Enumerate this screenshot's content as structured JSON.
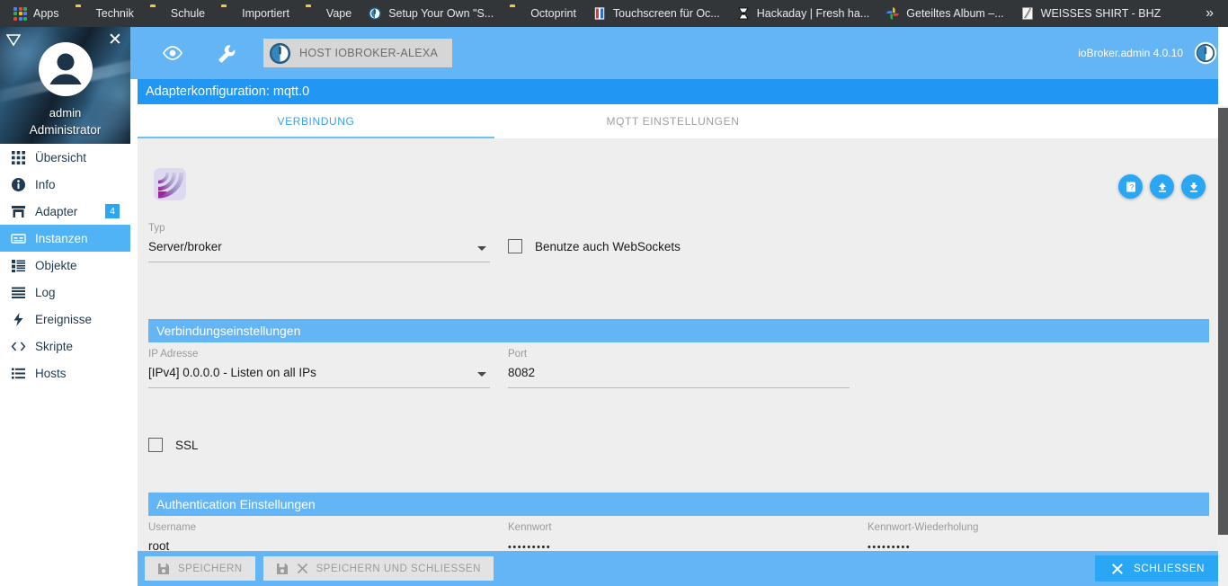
{
  "browser": {
    "bookmarks": [
      {
        "label": "Apps",
        "icon": "apps-grid-icon"
      },
      {
        "label": "Technik",
        "icon": "folder-icon"
      },
      {
        "label": "Schule",
        "icon": "folder-icon"
      },
      {
        "label": "Importiert",
        "icon": "folder-icon"
      },
      {
        "label": "Vape",
        "icon": "folder-icon"
      },
      {
        "label": "Setup Your Own \"S...",
        "icon": "iobroker-icon"
      },
      {
        "label": "Octoprint",
        "icon": "folder-icon"
      },
      {
        "label": "Touchscreen für Oc...",
        "icon": "site-icon"
      },
      {
        "label": "Hackaday | Fresh ha...",
        "icon": "hackaday-icon"
      },
      {
        "label": "Geteiltes Album –...",
        "icon": "google-photos-icon"
      },
      {
        "label": "WEISSES SHIRT - BHZ",
        "icon": "music-icon"
      }
    ],
    "overflow_label": "»"
  },
  "sidebar": {
    "user": "admin",
    "role": "Administrator",
    "items": [
      {
        "label": "Übersicht",
        "icon": "grid-icon",
        "active": false,
        "badge": ""
      },
      {
        "label": "Info",
        "icon": "info-icon",
        "active": false,
        "badge": ""
      },
      {
        "label": "Adapter",
        "icon": "store-icon",
        "active": false,
        "badge": "4"
      },
      {
        "label": "Instanzen",
        "icon": "instance-icon",
        "active": true,
        "badge": ""
      },
      {
        "label": "Objekte",
        "icon": "list-icon",
        "active": false,
        "badge": ""
      },
      {
        "label": "Log",
        "icon": "log-icon",
        "active": false,
        "badge": ""
      },
      {
        "label": "Ereignisse",
        "icon": "bolt-icon",
        "active": false,
        "badge": ""
      },
      {
        "label": "Skripte",
        "icon": "code-icon",
        "active": false,
        "badge": ""
      },
      {
        "label": "Hosts",
        "icon": "hosts-icon",
        "active": false,
        "badge": ""
      }
    ]
  },
  "topbar": {
    "host_chip": "HOST IOBROKER-ALEXA",
    "version": "ioBroker.admin 4.0.10"
  },
  "dialog": {
    "title": "Adapterkonfiguration: mqtt.0",
    "tabs": [
      {
        "label": "VERBINDUNG",
        "active": true
      },
      {
        "label": "MQTT EINSTELLUNGEN",
        "active": false
      }
    ],
    "actions": {
      "help_icon": "book-help-icon",
      "upload_icon": "upload-icon",
      "download_icon": "download-icon"
    },
    "fields": {
      "typ": {
        "label": "Typ",
        "value": "Server/broker"
      },
      "websockets": {
        "label": "Benutze auch WebSockets",
        "checked": false
      },
      "ip": {
        "label": "IP Adresse",
        "value": "[IPv4] 0.0.0.0 - Listen on all IPs"
      },
      "port": {
        "label": "Port",
        "value": "8082"
      },
      "ssl": {
        "label": "SSL",
        "checked": false
      },
      "username": {
        "label": "Username",
        "value": "root"
      },
      "password": {
        "label": "Kennwort",
        "value": "•••••••••"
      },
      "password_repeat": {
        "label": "Kennwort-Wiederholung",
        "value": "•••••••••"
      }
    },
    "sections": {
      "connection": "Verbindungseinstellungen",
      "authentication": "Authentication Einstellungen"
    },
    "footer": {
      "save": "SPEICHERN",
      "save_close": "SPEICHERN UND SCHLIESSEN",
      "close": "SCHLIESSEN"
    }
  },
  "colors": {
    "accent": "#29A7F5",
    "title_bar": "#2196F3",
    "section_bar": "#64B5F6",
    "form_bg": "#eeeeee"
  }
}
